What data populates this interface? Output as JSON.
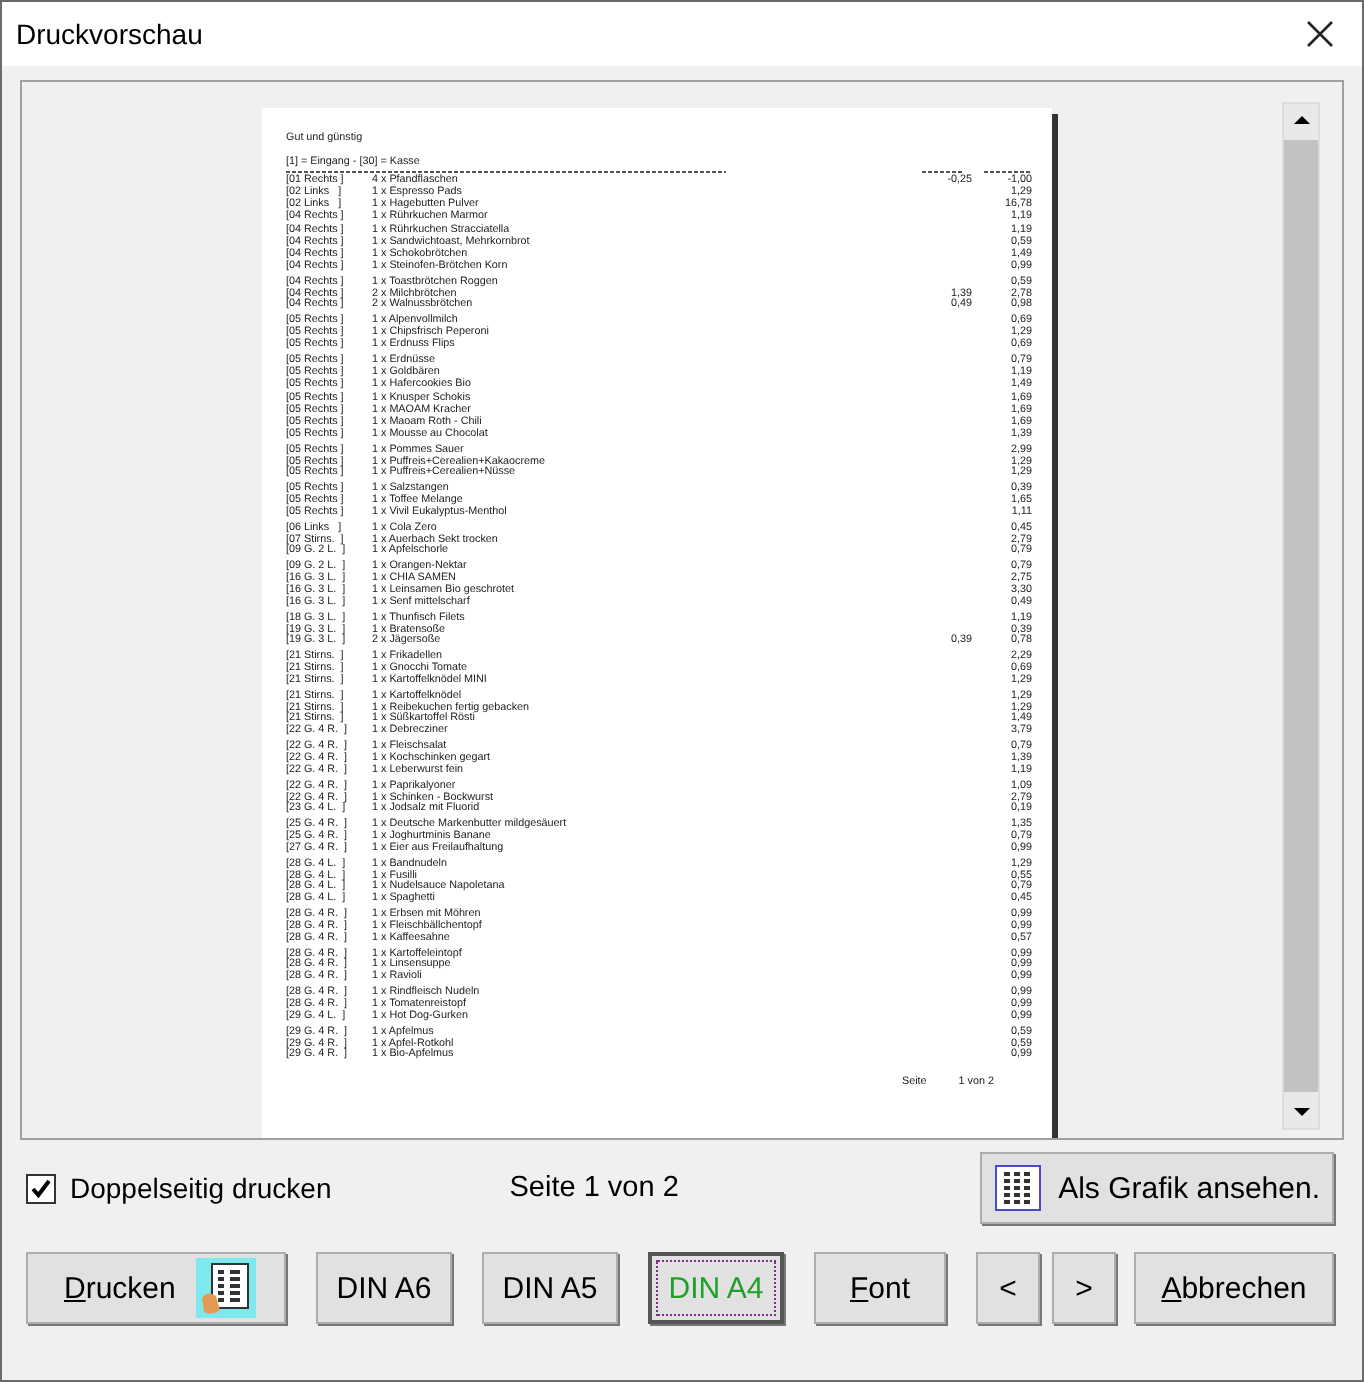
{
  "window": {
    "title": "Druckvorschau"
  },
  "document": {
    "title": "Gut und günstig",
    "legend": "[1] = Eingang  - [30] = Kasse",
    "groups": [
      [
        {
          "position": "[01 Rechts ]",
          "item": "4 x Pfandflaschen",
          "unit_price": "-0,25",
          "total": "-1,00"
        },
        {
          "position": "[02 Links   ]",
          "item": "1 x Espresso Pads",
          "total": "1,29"
        },
        {
          "position": "[02 Links   ]",
          "item": "1 x Hagebutten Pulver",
          "total": "16,78"
        },
        {
          "position": "[04 Rechts ]",
          "item": "1 x Rührkuchen Marmor",
          "total": "1,19"
        }
      ],
      [
        {
          "position": "[04 Rechts ]",
          "item": "1 x Rührkuchen Stracciatella",
          "total": "1,19"
        },
        {
          "position": "[04 Rechts ]",
          "item": "1 x Sandwichtoast, Mehrkornbrot",
          "total": "0,59"
        },
        {
          "position": "[04 Rechts ]",
          "item": "1 x Schokobrötchen",
          "total": "1,49"
        },
        {
          "position": "[04 Rechts ]",
          "item": "1 x Steinofen-Brötchen Korn",
          "total": "0,99"
        }
      ],
      [
        {
          "position": "[04 Rechts ]",
          "item": "1 x Toastbrötchen Roggen",
          "total": "0,59"
        },
        {
          "position": "[04 Rechts ]",
          "item": "2 x Milchbrötchen",
          "unit_price": "1,39",
          "total": "2,78"
        },
        {
          "position": "[04 Rechts ]",
          "item": "2 x Walnussbrötchen",
          "unit_price": "0,49",
          "total": "0,98"
        }
      ],
      [
        {
          "position": "[05 Rechts ]",
          "item": "1 x Alpenvollmilch",
          "total": "0,69"
        },
        {
          "position": "[05 Rechts ]",
          "item": "1 x Chipsfrisch Peperoni",
          "total": "1,29"
        },
        {
          "position": "[05 Rechts ]",
          "item": "1 x Erdnuss Flips",
          "total": "0,69"
        }
      ],
      [
        {
          "position": "[05 Rechts ]",
          "item": "1 x Erdnüsse",
          "total": "0,79"
        },
        {
          "position": "[05 Rechts ]",
          "item": "1 x Goldbären",
          "total": "1,19"
        },
        {
          "position": "[05 Rechts ]",
          "item": "1 x Hafercookies Bio",
          "total": "1,49"
        }
      ],
      [
        {
          "position": "[05 Rechts ]",
          "item": "1 x Knusper Schokis",
          "total": "1,69"
        },
        {
          "position": "[05 Rechts ]",
          "item": "1 x MAOAM Kracher",
          "total": "1,69"
        },
        {
          "position": "[05 Rechts ]",
          "item": "1 x Maoam Roth - Chili",
          "total": "1,69"
        },
        {
          "position": "[05 Rechts ]",
          "item": "1 x Mousse au Chocolat",
          "total": "1,39"
        }
      ],
      [
        {
          "position": "[05 Rechts ]",
          "item": "1 x Pommes Sauer",
          "total": "2,99"
        },
        {
          "position": "[05 Rechts ]",
          "item": "1 x Puffreis+Cerealien+Kakaocreme",
          "total": "1,29"
        },
        {
          "position": "[05 Rechts ]",
          "item": "1 x Puffreis+Cerealien+Nüsse",
          "total": "1,29"
        }
      ],
      [
        {
          "position": "[05 Rechts ]",
          "item": "1 x Salzstangen",
          "total": "0,39"
        },
        {
          "position": "[05 Rechts ]",
          "item": "1 x Toffee Melange",
          "total": "1,65"
        },
        {
          "position": "[05 Rechts ]",
          "item": "1 x Vivil Eukalyptus-Menthol",
          "total": "1,11"
        }
      ],
      [
        {
          "position": "[06 Links   ]",
          "item": "1 x Cola Zero",
          "total": "0,45"
        },
        {
          "position": "[07 Stirns.  ]",
          "item": "1 x Auerbach Sekt trocken",
          "total": "2,79"
        },
        {
          "position": "[09 G. 2 L.  ]",
          "item": "1 x Apfelschorle",
          "total": "0,79"
        }
      ],
      [
        {
          "position": "[09 G. 2 L.  ]",
          "item": "1 x Orangen-Nektar",
          "total": "0,79"
        },
        {
          "position": "[16 G. 3 L.  ]",
          "item": "1 x CHIA SAMEN",
          "total": "2,75"
        },
        {
          "position": "[16 G. 3 L.  ]",
          "item": "1 x Leinsamen Bio geschrotet",
          "total": "3,30"
        },
        {
          "position": "[16 G. 3 L.  ]",
          "item": "1 x Senf mittelscharf",
          "total": "0,49"
        }
      ],
      [
        {
          "position": "[18 G. 3 L.  ]",
          "item": "1 x Thunfisch Filets",
          "total": "1,19"
        },
        {
          "position": "[19 G. 3 L.  ]",
          "item": "1 x Bratensoße",
          "total": "0,39"
        },
        {
          "position": "[19 G. 3 L.  ]",
          "item": "2 x Jägersoße",
          "unit_price": "0,39",
          "total": "0,78"
        }
      ],
      [
        {
          "position": "[21 Stirns.  ]",
          "item": "1 x Frikadellen",
          "total": "2,29"
        },
        {
          "position": "[21 Stirns.  ]",
          "item": "1 x Gnocchi Tomate",
          "total": "0,69"
        },
        {
          "position": "[21 Stirns.  ]",
          "item": "1 x Kartoffelknödel MINI",
          "total": "1,29"
        }
      ],
      [
        {
          "position": "[21 Stirns.  ]",
          "item": "1 x Kartoffelknödel",
          "total": "1,29"
        },
        {
          "position": "[21 Stirns.  ]",
          "item": "1 x Reibekuchen fertig gebacken",
          "total": "1,29"
        },
        {
          "position": "[21 Stirns.  ]",
          "item": "1 x Süßkartoffel Rösti",
          "total": "1,49"
        },
        {
          "position": "[22 G. 4 R.  ]",
          "item": "1 x Debrecziner",
          "total": "3,79"
        }
      ],
      [
        {
          "position": "[22 G. 4 R.  ]",
          "item": "1 x Fleischsalat",
          "total": "0,79"
        },
        {
          "position": "[22 G. 4 R.  ]",
          "item": "1 x Kochschinken gegart",
          "total": "1,39"
        },
        {
          "position": "[22 G. 4 R.  ]",
          "item": "1 x Leberwurst fein",
          "total": "1,19"
        }
      ],
      [
        {
          "position": "[22 G. 4 R.  ]",
          "item": "1 x Paprikalyoner",
          "total": "1,09"
        },
        {
          "position": "[22 G. 4 R.  ]",
          "item": "1 x Schinken - Bockwurst",
          "total": "2,79"
        },
        {
          "position": "[23 G. 4 L.  ]",
          "item": "1 x Jodsalz mit Fluorid",
          "total": "0,19"
        }
      ],
      [
        {
          "position": "[25 G. 4 R.  ]",
          "item": "1 x Deutsche Markenbutter mildgesäuert",
          "total": "1,35"
        },
        {
          "position": "[25 G. 4 R.  ]",
          "item": "1 x Joghurtminis Banane",
          "total": "0,79"
        },
        {
          "position": "[27 G. 4 R.  ]",
          "item": "1 x Eier aus Freilaufhaltung",
          "total": "0,99"
        }
      ],
      [
        {
          "position": "[28 G. 4 L.  ]",
          "item": "1 x Bandnudeln",
          "total": "1,29"
        },
        {
          "position": "[28 G. 4 L.  ]",
          "item": "1 x Fusilli",
          "total": "0,55"
        },
        {
          "position": "[28 G. 4 L.  ]",
          "item": "1 x Nudelsauce Napoletana",
          "total": "0,79"
        },
        {
          "position": "[28 G. 4 L.  ]",
          "item": "1 x Spaghetti",
          "total": "0,45"
        }
      ],
      [
        {
          "position": "[28 G. 4 R.  ]",
          "item": "1 x Erbsen mit Möhren",
          "total": "0,99"
        },
        {
          "position": "[28 G. 4 R.  ]",
          "item": "1 x Fleischbällchentopf",
          "total": "0,99"
        },
        {
          "position": "[28 G. 4 R.  ]",
          "item": "1 x Kaffeesahne",
          "total": "0,57"
        }
      ],
      [
        {
          "position": "[28 G. 4 R.  ]",
          "item": "1 x Kartoffeleintopf",
          "total": "0,99"
        },
        {
          "position": "[28 G. 4 R.  ]",
          "item": "1 x Linsensuppe",
          "total": "0,99"
        },
        {
          "position": "[28 G. 4 R.  ]",
          "item": "1 x Ravioli",
          "total": "0,99"
        }
      ],
      [
        {
          "position": "[28 G. 4 R.  ]",
          "item": "1 x Rindfleisch Nudeln",
          "total": "0,99"
        },
        {
          "position": "[28 G. 4 R.  ]",
          "item": "1 x Tomatenreistopf",
          "total": "0,99"
        },
        {
          "position": "[29 G. 4 L.  ]",
          "item": "1 x Hot Dog-Gurken",
          "total": "0,99"
        }
      ],
      [
        {
          "position": "[29 G. 4 R.  ]",
          "item": "1 x Apfelmus",
          "total": "0,59"
        },
        {
          "position": "[29 G. 4 R.  ]",
          "item": "1 x Apfel-Rotkohl",
          "total": "0,59"
        },
        {
          "position": "[29 G. 4 R.  ]",
          "item": "1 x Bio-Apfelmus",
          "total": "0,99"
        }
      ]
    ],
    "footer": {
      "label": "Seite",
      "value": "1 von 2"
    }
  },
  "duplex": {
    "label": "Doppelseitig drucken",
    "checked": true
  },
  "page_indicator": "Seite 1 von 2",
  "graphic_button": {
    "label": "Als Grafik ansehen."
  },
  "print_button": {
    "mnemonic": "D",
    "label": "rucken"
  },
  "paper_sizes": [
    {
      "label": "DIN A6",
      "selected": false
    },
    {
      "label": "DIN A5",
      "selected": false
    },
    {
      "label": "DIN A4",
      "selected": true
    }
  ],
  "font_button": {
    "mnemonic": "F",
    "label": "ont"
  },
  "nav_buttons": [
    "<",
    ">"
  ],
  "cancel_button": {
    "mnemonic": "A",
    "label": "bbrechen"
  }
}
